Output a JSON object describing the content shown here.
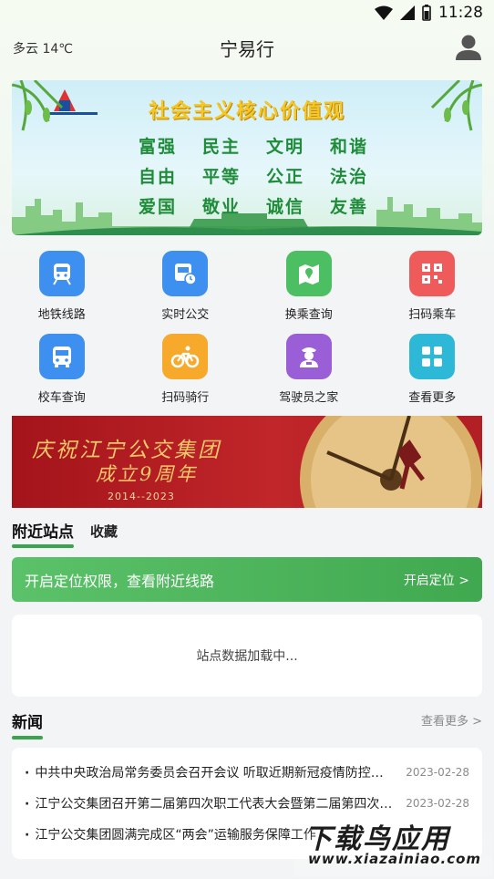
{
  "status_bar": {
    "time": "11:28"
  },
  "header": {
    "weather": "多云 14℃",
    "title": "宁易行"
  },
  "banner": {
    "title": "社会主义核心价值观",
    "values": [
      "富强",
      "民主",
      "文明",
      "和谐",
      "自由",
      "平等",
      "公正",
      "法治",
      "爱国",
      "敬业",
      "诚信",
      "友善"
    ]
  },
  "quick_actions": [
    {
      "label": "地铁线路",
      "icon": "metro-icon",
      "color": "#3d8ff0"
    },
    {
      "label": "实时公交",
      "icon": "bus-clock-icon",
      "color": "#3d8ff0"
    },
    {
      "label": "换乘查询",
      "icon": "map-pin-icon",
      "color": "#4cbf63"
    },
    {
      "label": "扫码乘车",
      "icon": "qr-code-icon",
      "color": "#ef5b5b"
    },
    {
      "label": "校车查询",
      "icon": "school-bus-icon",
      "color": "#3d8ff0"
    },
    {
      "label": "扫码骑行",
      "icon": "bicycle-icon",
      "color": "#f7a92b"
    },
    {
      "label": "驾驶员之家",
      "icon": "driver-icon",
      "color": "#9a5fd6"
    },
    {
      "label": "查看更多",
      "icon": "grid-more-icon",
      "color": "#2db8d8"
    }
  ],
  "promo": {
    "line1": "庆祝江宁公交集团",
    "line2": "成立9周年",
    "years": "2014--2023"
  },
  "stations": {
    "tab_nearby": "附近站点",
    "tab_favorites": "收藏",
    "locate_text": "开启定位权限，查看附近线路",
    "locate_button": "开启定位 >",
    "loading": "站点数据加载中..."
  },
  "news": {
    "title": "新闻",
    "more": "查看更多 >",
    "items": [
      {
        "text": "中共中央政治局常务委员会召开会议 听取近期新冠疫情防控工作情况汇报",
        "date": "2023-02-28"
      },
      {
        "text": "江宁公交集团召开第二届第四次职工代表大会暨第二届第四次工会会员代表大会",
        "date": "2023-02-28"
      },
      {
        "text": "江宁公交集团圆满完成区“两会”运输服务保障工作",
        "date": ""
      }
    ]
  },
  "watermark": {
    "top": "下载鸟应用",
    "bottom": "www.xiazainiao.com"
  }
}
